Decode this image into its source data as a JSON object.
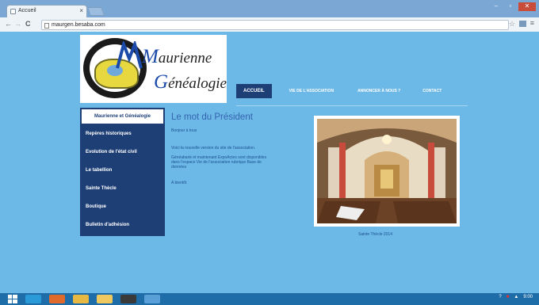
{
  "browser": {
    "tab_title": "Accueil",
    "tab_close": "×",
    "url": "maurgen.besaba.com",
    "back": "←",
    "forward": "→",
    "reload": "C",
    "star": "☆",
    "menu": "≡"
  },
  "logo": {
    "line1_cap": "M",
    "line1_rest": "aurienne",
    "line2_cap": "G",
    "line2_rest": "énéalogie"
  },
  "topnav": {
    "items": [
      {
        "label": "ACCUEIL"
      },
      {
        "label": "VIE DE L'ASSOCIATION"
      },
      {
        "label": "ANNONCER À NOUS ?"
      },
      {
        "label": "CONTACT"
      }
    ]
  },
  "sidenav": {
    "items": [
      {
        "label": "Maurienne et Généalogie"
      },
      {
        "label": "Repères historiques"
      },
      {
        "label": "Evolution de l'état civil"
      },
      {
        "label": "Le tabellion"
      },
      {
        "label": "Sainte Thècle"
      },
      {
        "label": "Boutique"
      },
      {
        "label": "Bulletin d'adhésion"
      }
    ]
  },
  "content": {
    "heading": "Le mot du Président",
    "greeting": "Bonjour à tous",
    "p1": "Voici la nouvelle version du site de l'association.",
    "p2": "Généabank et maintenant ExpoActes sont disponibles dans l'espace Vie de l'association rubrique Base de données",
    "closing": "A bientôt"
  },
  "photo": {
    "caption": "Sainte Thècle 2014"
  },
  "taskbar": {
    "time": "9:00"
  },
  "colors": {
    "page_bg": "#6cb8e6",
    "nav_dark": "#1e3f76",
    "heading_blue": "#3565b0"
  }
}
